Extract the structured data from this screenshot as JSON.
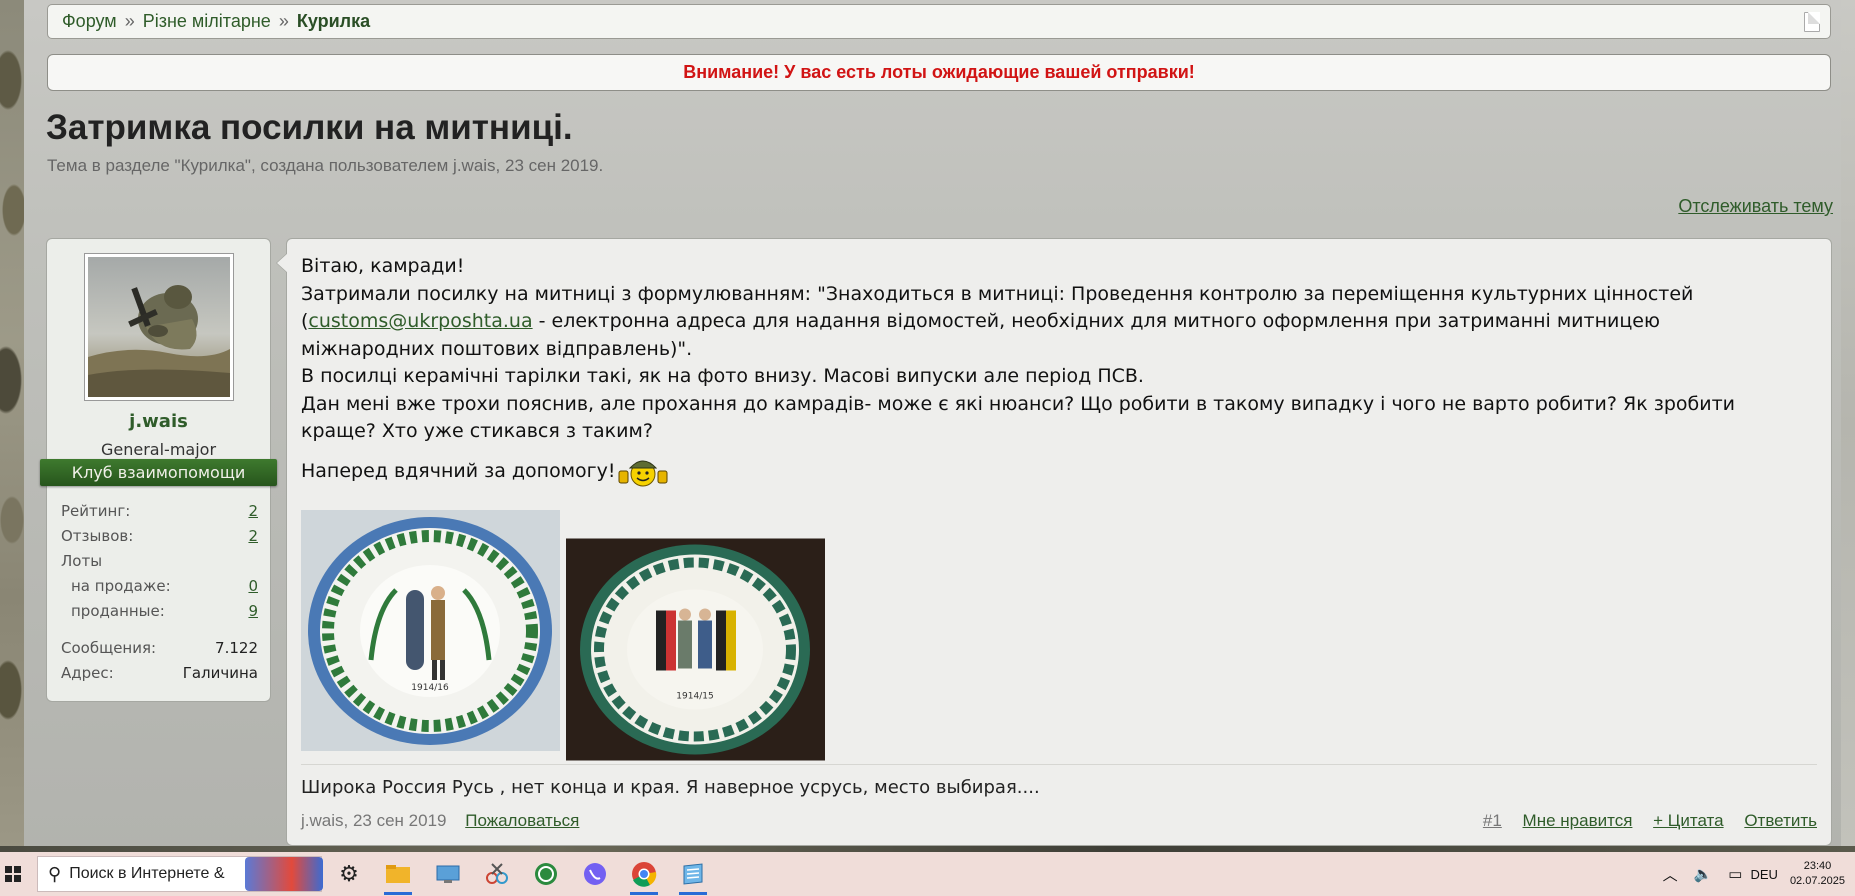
{
  "breadcrumb": {
    "items": [
      "Форум",
      "Різне мілітарне"
    ],
    "separator": "»",
    "current": "Курилка"
  },
  "alert": {
    "text": "Внимание! У вас есть лоты ожидающие вашей отправки!",
    "color": "#d11414"
  },
  "thread": {
    "title": "Затримка посилки на митниці.",
    "meta": "Тема в разделе \"Курилка\", создана пользователем j.wais, 23 сен 2019.",
    "watch_label": "Отслеживать тему"
  },
  "user": {
    "name": "j.wais",
    "title": "General-major",
    "club": "Клуб взаимопомощи",
    "stats": {
      "rating_label": "Рейтинг:",
      "rating": "2",
      "reviews_label": "Отзывов:",
      "reviews": "2",
      "lots_label": "Лоты",
      "on_sale_label": "на продаже:",
      "on_sale": "0",
      "sold_label": "проданные:",
      "sold": "9",
      "messages_label": "Сообщения:",
      "messages": "7.122",
      "address_label": "Адрес:",
      "address": "Галичина"
    }
  },
  "post": {
    "greeting": "Вітаю, камради!",
    "line1_a": "Затримали посилку на митниці з формулюванням: \"Знаходиться в митниці: Проведення контролю за переміщення культурних цінностей",
    "line2_open": "(",
    "email": "customs@ukrposhta.ua",
    "line2_b": " - електронна адреса для надання відомостей, необхідних для митного оформлення при затриманні митницею",
    "line3": "міжнародних поштових відправлень)\".",
    "line4": "В посилці керамічні тарілки такі, як на фото внизу. Масові випуски але період ПСВ.",
    "line5": "Дан мені вже трохи пояснив, але прохання до камрадів- може є які нюанси? Що робити в такому випадку і чого не варто робити? Як зробити",
    "line6": "краще? Хто уже стикався з таким?",
    "thanks": "Наперед вдячний за допомогу!",
    "plate1_year": "1914/16",
    "plate2_year": "1914/15",
    "signature": "Широка Россия Русь , нет конца и края. Я наверное усрусь, место выбирая....",
    "footer": {
      "author": "j.wais",
      "date": "23 сен 2019",
      "report": "Пожаловаться",
      "number": "#1",
      "like": "Мне нравится",
      "quote": "+ Цитата",
      "reply": "Ответить"
    }
  },
  "taskbar": {
    "search_placeholder": "Поиск в Интернете &",
    "lang": "DEU",
    "time": "23:40",
    "date": "02.07.2025",
    "icons": [
      "settings-icon",
      "file-explorer-icon",
      "remote-desktop-icon",
      "snipping-tool-icon",
      "whatsapp-icon",
      "viber-icon",
      "chrome-icon",
      "notepad-icon"
    ]
  },
  "colors": {
    "link": "#2f5c2a",
    "club": "#2f6a25"
  }
}
